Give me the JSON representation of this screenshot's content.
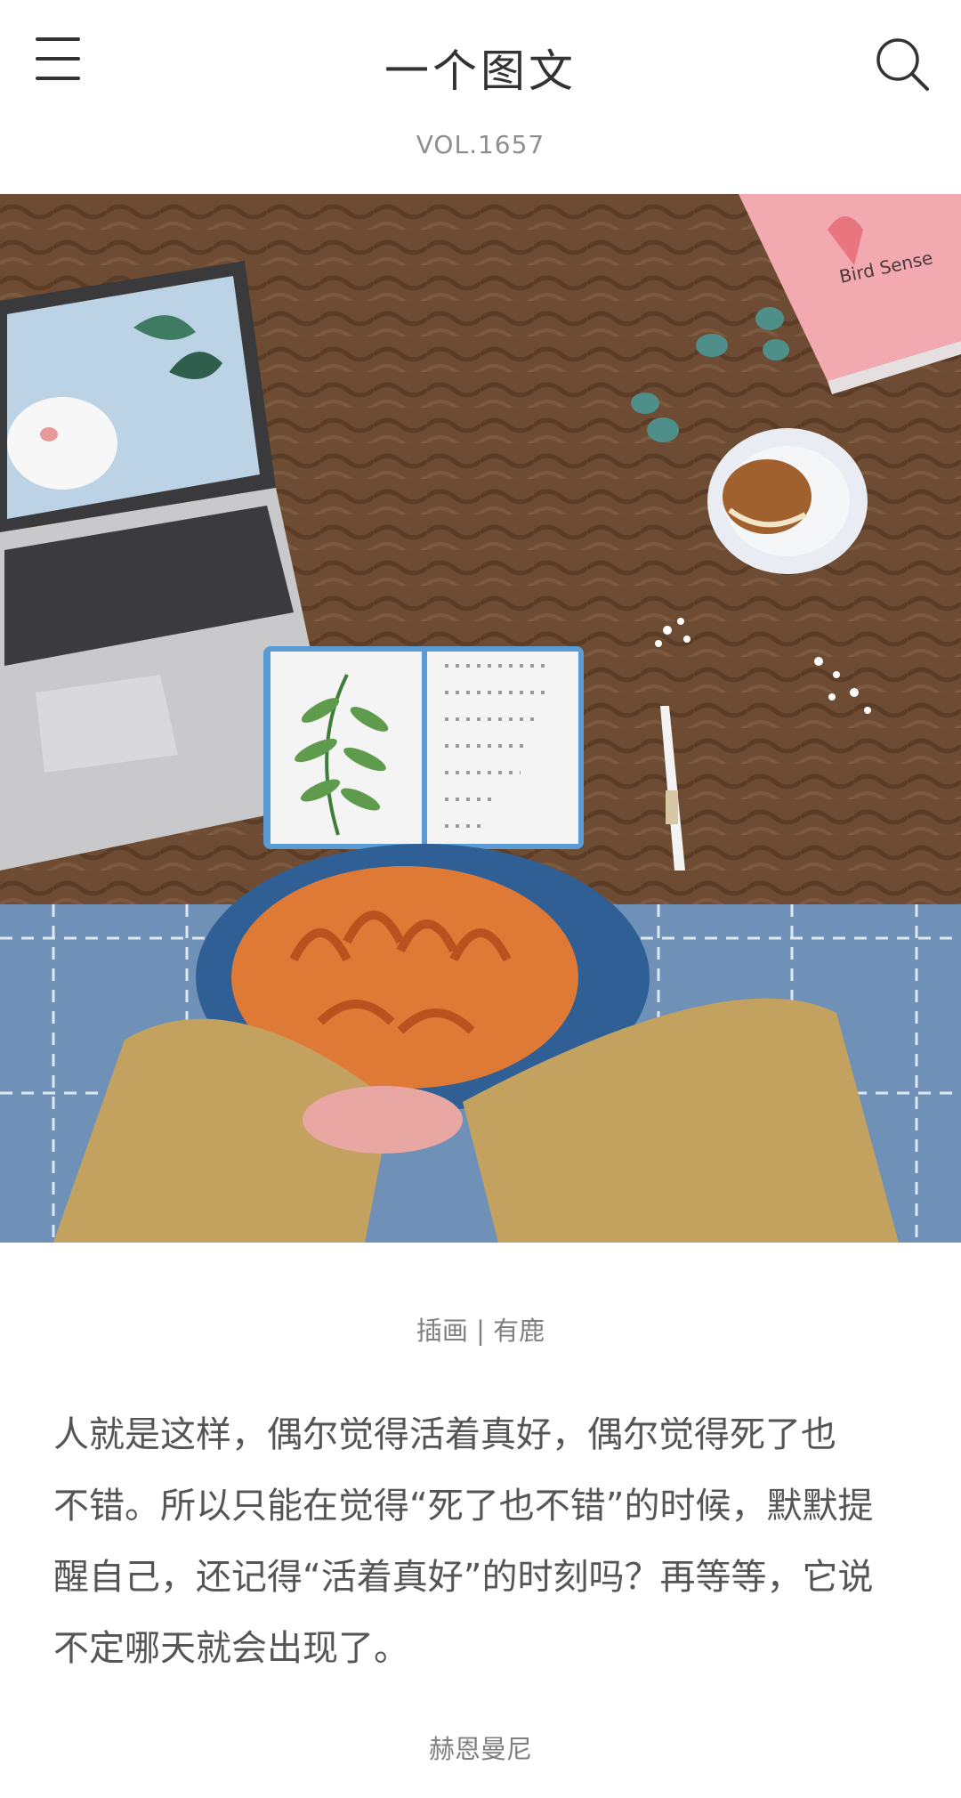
{
  "header": {
    "title": "一个图文",
    "menu_icon": "hamburger-menu-icon",
    "search_icon": "search-icon"
  },
  "volume": "VOL.1657",
  "illustration": {
    "book_title": "Bird Sense"
  },
  "caption": "插画 | 有鹿",
  "body": {
    "lines": [
      "人就是这样，偶尔觉得活着真好，偶尔觉得死了也",
      "不错。所以只能在觉得“死了也不错”的时候，默默提",
      "醒自己，还记得“活着真好”的时刻吗？再等等，它说",
      "不定哪天就会出现了。"
    ]
  },
  "author": "赫恩曼尼",
  "colors": {
    "text_primary": "#333333",
    "text_secondary": "#8f8f8f",
    "table_brown": "#6b4a31",
    "floor_blue": "#6d8fb6"
  }
}
